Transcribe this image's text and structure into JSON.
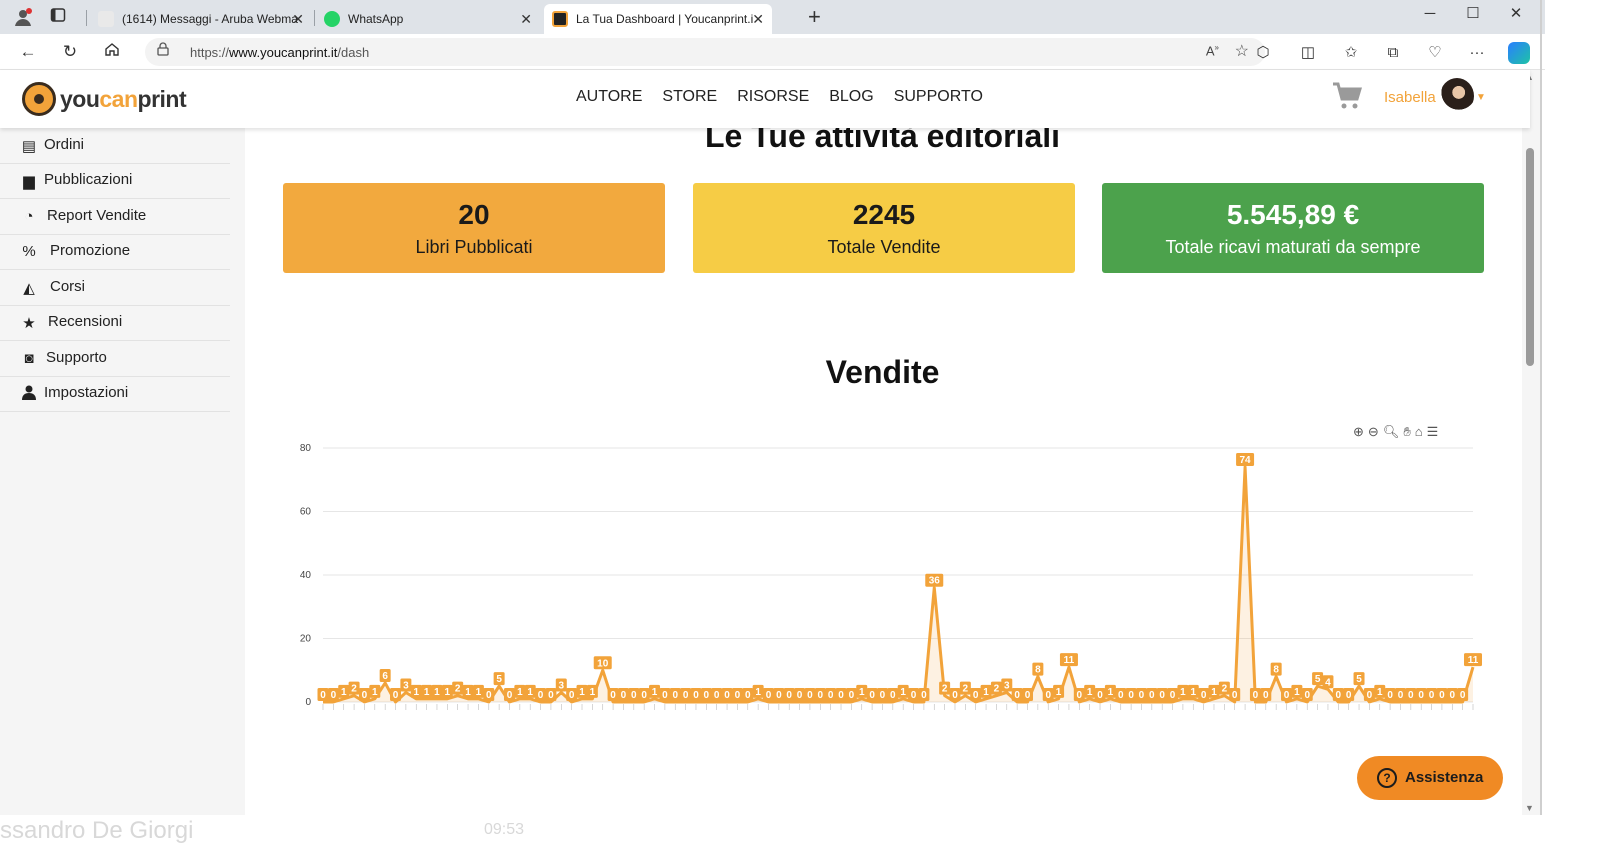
{
  "browser": {
    "tabs": [
      {
        "title": "(1614) Messaggi - Aruba Webma",
        "active": false
      },
      {
        "title": "WhatsApp",
        "active": false
      },
      {
        "title": "La Tua Dashboard | Youcanprint.i",
        "active": true
      }
    ],
    "url_prefix": "https://",
    "url_domain": "www.youcanprint.it",
    "url_path": "/dash",
    "icons": [
      "profile-icon",
      "tab-actions-icon",
      "back-icon",
      "refresh-icon",
      "home-icon",
      "lock-icon",
      "read-aloud-icon",
      "favorite-star-icon",
      "extensions-icon",
      "split-screen-icon",
      "favorites-icon",
      "collections-icon",
      "browser-essentials-icon",
      "more-icon",
      "copilot-icon",
      "minimize-icon",
      "maximize-icon",
      "close-window-icon"
    ]
  },
  "site": {
    "logo_you": "you",
    "logo_can": "can",
    "logo_print": "print",
    "nav": [
      "AUTORE",
      "STORE",
      "RISORSE",
      "BLOG",
      "SUPPORTO"
    ],
    "user_name": "Isabella"
  },
  "sidebar": {
    "items": [
      {
        "label": "Ordini",
        "icon": "orders-icon"
      },
      {
        "label": "Pubblicazioni",
        "icon": "book-icon"
      },
      {
        "label": "Report Vendite",
        "icon": "pie-chart-icon"
      },
      {
        "label": "Promozione",
        "icon": "promotion-icon"
      },
      {
        "label": "Corsi",
        "icon": "graduation-cap-icon"
      },
      {
        "label": "Recensioni",
        "icon": "star-icon"
      },
      {
        "label": "Supporto",
        "icon": "headset-icon"
      },
      {
        "label": "Impostazioni",
        "icon": "user-icon"
      }
    ]
  },
  "main": {
    "title": "Le Tue attività editoriali",
    "stats": [
      {
        "value": "20",
        "label": "Libri Pubblicati",
        "bg": "#f2a93e",
        "fg": "#1a1a1a"
      },
      {
        "value": "2245",
        "label": "Totale Vendite",
        "bg": "#f6cc45",
        "fg": "#1a1a1a"
      },
      {
        "value": "5.545,89 €",
        "label": "Totale ricavi maturati da sempre",
        "bg": "#4ca24c",
        "fg": "#ffffff"
      }
    ],
    "chart_title": "Vendite"
  },
  "chart_data": {
    "type": "area",
    "title": "Vendite",
    "color": "#f2a33a",
    "ylim": [
      0,
      80
    ],
    "yticks": [
      0,
      20,
      40,
      60,
      80
    ],
    "grid": true,
    "values": [
      0,
      0,
      1,
      2,
      0,
      1,
      6,
      0,
      3,
      1,
      1,
      1,
      1,
      2,
      1,
      1,
      0,
      5,
      0,
      1,
      1,
      0,
      0,
      3,
      0,
      1,
      1,
      10,
      0,
      0,
      0,
      0,
      1,
      0,
      0,
      0,
      0,
      0,
      0,
      0,
      0,
      0,
      1,
      0,
      0,
      0,
      0,
      0,
      0,
      0,
      0,
      0,
      1,
      0,
      0,
      0,
      1,
      0,
      0,
      36,
      2,
      0,
      2,
      0,
      1,
      2,
      3,
      0,
      0,
      8,
      0,
      1,
      11,
      0,
      1,
      0,
      1,
      0,
      0,
      0,
      0,
      0,
      0,
      1,
      1,
      0,
      1,
      2,
      0,
      74,
      0,
      0,
      8,
      0,
      1,
      0,
      5,
      4,
      0,
      0,
      5,
      0,
      1,
      0,
      0,
      0,
      0,
      0,
      0,
      0,
      0,
      11
    ]
  },
  "assist": {
    "label": "Assistenza",
    "icon_glyph": "?"
  },
  "background_app": {
    "caller": "ssandro De Giorgi",
    "duration": "09:53"
  }
}
